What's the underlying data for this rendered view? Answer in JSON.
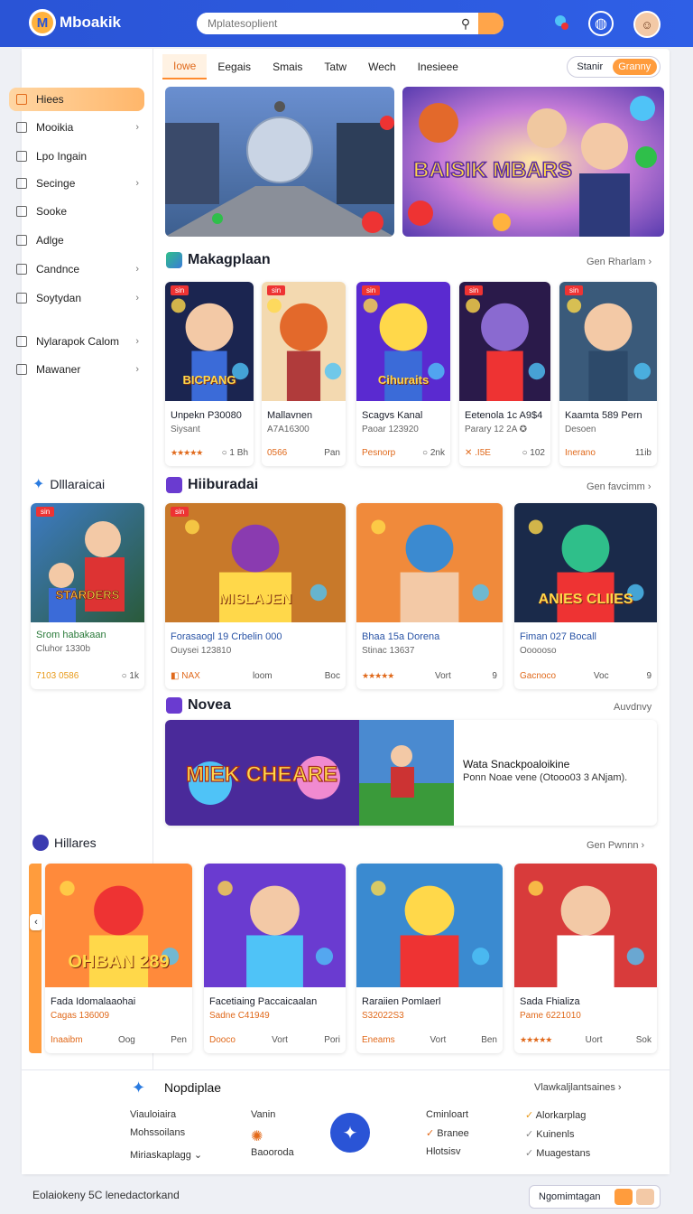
{
  "app": {
    "name": "Mboakik",
    "search_placeholder": "Mplatesoplient",
    "colors": {
      "brand": "#2a54d6",
      "accent": "#ff9c3d"
    }
  },
  "tabs": [
    "Iowe",
    "Eegais",
    "Smais",
    "Tatw",
    "Wech",
    "Inesieee"
  ],
  "toggle": {
    "off": "Stanir",
    "on": "Granny"
  },
  "sidebar": [
    {
      "label": "Hiees",
      "chevron": false
    },
    {
      "label": "Mooikia",
      "chevron": true
    },
    {
      "label": "Lpo Ingain",
      "chevron": false
    },
    {
      "label": "Secinge",
      "chevron": true
    },
    {
      "label": "Sooke",
      "chevron": false
    },
    {
      "label": "Adlge",
      "chevron": false
    },
    {
      "label": "Candnce",
      "chevron": true
    },
    {
      "label": "Soytydan",
      "chevron": true
    },
    {
      "label": "Nylarapok Calom",
      "chevron": true
    },
    {
      "label": "Mawaner",
      "chevron": true
    }
  ],
  "banner2_text": "BAISIK MBARS",
  "sec1": {
    "title": "Makagplaan",
    "see": "Gen Rharlam ›",
    "cards": [
      {
        "badge": "sin",
        "art": "BICPANG",
        "t1": "Unpekn P30080",
        "t2": "Siysant",
        "m1": "★★★★★",
        "m2": "○ 1 Bh"
      },
      {
        "badge": "sin",
        "art": "",
        "t1": "Mallavnen",
        "t2": "A7A16300",
        "m1": "0566",
        "m2": "Pan"
      },
      {
        "badge": "sin",
        "art": "Cihuraits",
        "t1": "Scagvs Kanal",
        "t2": "Paoar 123920",
        "m1": "Pesnorp",
        "m2": "○ 2nk"
      },
      {
        "badge": "sin",
        "art": "",
        "t1": "Eetenola 1c A9$4",
        "t2": "Parary 12 2A ✪",
        "m1": "✕ .I5E",
        "m2": "○ 102"
      },
      {
        "badge": "sin",
        "art": "",
        "t1": "Kaamta 589 Pern",
        "t2": "Desoen",
        "m1": "Inerano",
        "m2": "11ib"
      }
    ]
  },
  "side_promo": {
    "title": "Dlllaraicai",
    "badge": "sin",
    "art": "STARDERS",
    "t1": "Srom habakaan",
    "t2": "Cluhor 1330b",
    "m1": "7103 0586",
    "m2": "○ 1k"
  },
  "sec2": {
    "title": "Hiiburadai",
    "see": "Gen favcimm ›",
    "cards": [
      {
        "badge": "sin",
        "art": "MISLAJEN",
        "t1": "Forasaogl 19 Crbelin 000",
        "t2": "Ouysei 123810",
        "m1": "◧ NAX",
        "m2": "loom",
        "m3": "Boc"
      },
      {
        "badge": "",
        "art": "",
        "t1": "Bhaa 15a Dorena",
        "t2": "Stinac 13637",
        "m1": "★★★★★",
        "m2": "Vort",
        "m3": "9"
      },
      {
        "badge": "",
        "art": "ANIES CLIIES",
        "t1": "Fiman 027 Bocall",
        "t2": "Oooooso",
        "m1": "Gacnoco",
        "m2": "Voc",
        "m3": "9"
      }
    ]
  },
  "sec3": {
    "title": "Novea",
    "see": "Auvdnvy",
    "art": "MIEK CHEARE",
    "heading": "Wata Snackpoaloikine",
    "sub": "Ponn Noae vene (Otooo03 3 ANjam)."
  },
  "sec4": {
    "title": "Hillares",
    "see": "Gen Pwnnn ›",
    "cards": [
      {
        "art": "OHBAN 289",
        "t1": "Fada Idomalaaohai",
        "t2": "Cagas 136009",
        "m1": "Inaaibm",
        "m2": "Oog",
        "m3": "Pen"
      },
      {
        "art": "",
        "t1": "Facetiaing Paccaicaalan",
        "t2": "Sadne C41949",
        "m1": "Dooco",
        "m2": "Vort",
        "m3": "Pori"
      },
      {
        "art": "",
        "t1": "Raraiien Pomlaerl",
        "t2": "S32022S3",
        "m1": "Eneams",
        "m2": "Vort",
        "m3": "Ben"
      },
      {
        "art": "",
        "t1": "Sada Fhializa",
        "t2": "Pame 6221010",
        "m1": "★★★★★",
        "m2": "Uort",
        "m3": "Sok"
      }
    ]
  },
  "footer": {
    "brand": "Nopdiplae",
    "link": "Vlawkaljlantsaines ›",
    "c1": [
      "Viauloiaira",
      "Mohssoilans",
      "Miriaskaplagg ⌄"
    ],
    "c2": [
      "Vanin",
      "Baooroda"
    ],
    "c3": [
      "Cminloart",
      "Branee",
      "Hlotsisv"
    ],
    "c4": [
      "Alorkarplag",
      "Kuinenls",
      "Muagestans"
    ]
  },
  "bottom": {
    "text": "Eolaiokeny 5C lenedactorkand",
    "pill": "Ngomimtagan"
  }
}
